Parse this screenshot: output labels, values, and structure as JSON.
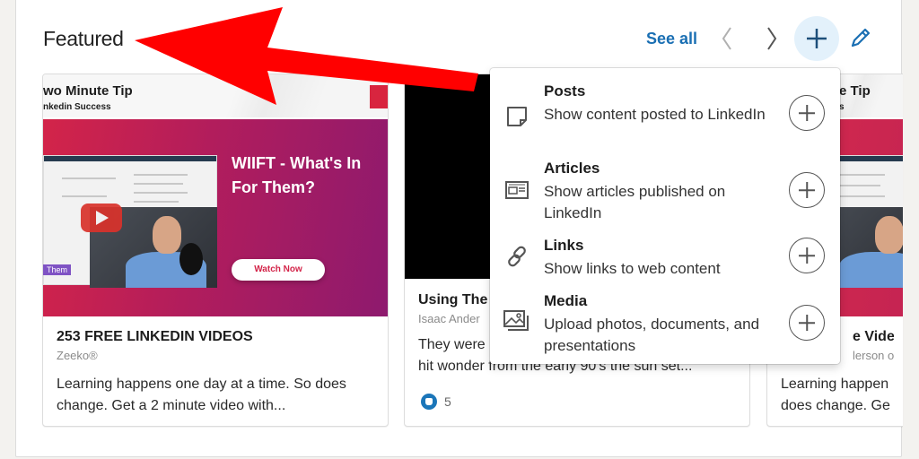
{
  "section": {
    "title": "Featured",
    "see_all_label": "See all",
    "prev_icon": "chevron-left-icon",
    "next_icon": "chevron-right-icon",
    "add_icon": "plus-icon",
    "edit_icon": "pencil-icon"
  },
  "cards": [
    {
      "thumb": {
        "tip_title": "wo Minute Tip",
        "tip_sub": "nkedin Success",
        "headline_line1": "WIIFT - What's In",
        "headline_line2": "For Them?",
        "button": "Watch Now",
        "tag": "Them"
      },
      "title": "253 FREE LINKEDIN VIDEOS",
      "subtitle": "Zeeko®",
      "description": "Learning happens one day at a time. So does change. Get a 2 minute video with..."
    },
    {
      "title": "Using The",
      "subtitle": "Isaac Ander",
      "description": "They were... hit wonder from the early 90's the sun set...",
      "description_line1": "They were",
      "description_line2": "hit wonder from the early 90's the sun set...",
      "reactions": {
        "icon": "like-icon",
        "count": "5"
      }
    },
    {
      "thumb": {
        "tip_title": "e Tip",
        "tip_sub": "s"
      },
      "title": "e Videos",
      "subtitle": "lerson on L",
      "description_line1": "Learning happen",
      "description_line2": "does change. Ge"
    }
  ],
  "dropdown": {
    "items": [
      {
        "icon": "post-icon",
        "label": "Posts",
        "description": "Show content posted to LinkedIn",
        "add_icon": "add-circle-icon"
      },
      {
        "icon": "article-icon",
        "label": "Articles",
        "description": "Show articles published on LinkedIn",
        "add_icon": "add-circle-icon"
      },
      {
        "icon": "link-icon",
        "label": "Links",
        "description": "Show links to web content",
        "add_icon": "add-circle-icon"
      },
      {
        "icon": "media-icon",
        "label": "Media",
        "description": "Upload photos, documents, and presentations",
        "add_icon": "add-circle-icon"
      }
    ]
  },
  "annotation": {
    "type": "arrow",
    "color": "#ff0000"
  }
}
